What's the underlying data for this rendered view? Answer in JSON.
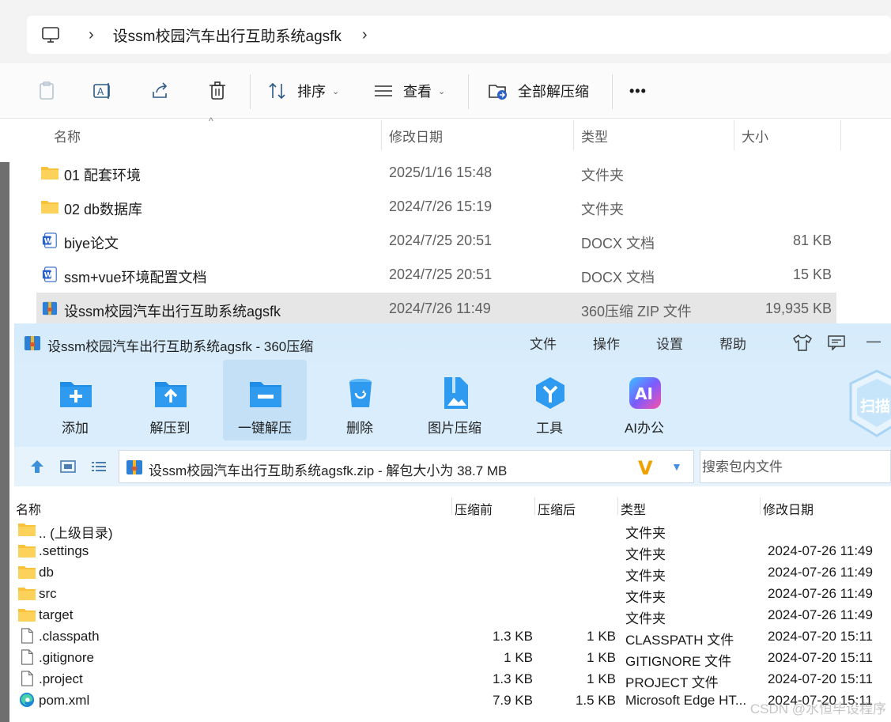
{
  "explorer": {
    "breadcrumb": "设ssm校园汽车出行互助系统agsfk",
    "toolbar": {
      "sort_label": "排序",
      "view_label": "查看",
      "extract_all_label": "全部解压缩",
      "more_label": "•••"
    },
    "columns": {
      "name": "名称",
      "modified": "修改日期",
      "type": "类型",
      "size": "大小"
    },
    "files": [
      {
        "name": "01 配套环境",
        "date": "2025/1/16 15:48",
        "type": "文件夹",
        "size": "",
        "icon": "folder-icon"
      },
      {
        "name": "02 db数据库",
        "date": "2024/7/26 15:19",
        "type": "文件夹",
        "size": "",
        "icon": "folder-icon"
      },
      {
        "name": "biye论文",
        "date": "2024/7/25 20:51",
        "type": "DOCX 文档",
        "size": "81 KB",
        "icon": "word-doc-icon"
      },
      {
        "name": "ssm+vue环境配置文档",
        "date": "2024/7/25 20:51",
        "type": "DOCX 文档",
        "size": "15 KB",
        "icon": "word-doc-icon"
      },
      {
        "name": "设ssm校园汽车出行互助系统agsfk",
        "date": "2024/7/26 11:49",
        "type": "360压缩 ZIP 文件",
        "size": "19,935 KB",
        "icon": "zip-archive-icon",
        "selected": true
      }
    ]
  },
  "archiver": {
    "title": "设ssm校园汽车出行互助系统agsfk - 360压缩",
    "menu": [
      "文件",
      "操作",
      "设置",
      "帮助"
    ],
    "minimize_label": "—",
    "ribbon": [
      {
        "label": "添加",
        "icon": "add-icon"
      },
      {
        "label": "解压到",
        "icon": "extract-to-icon"
      },
      {
        "label": "一键解压",
        "icon": "one-click-extract-icon"
      },
      {
        "label": "删除",
        "icon": "delete-icon"
      },
      {
        "label": "图片压缩",
        "icon": "image-compress-icon"
      },
      {
        "label": "工具",
        "icon": "tools-icon"
      },
      {
        "label": "AI办公",
        "icon": "ai-office-icon"
      }
    ],
    "ai_badge": "AI",
    "scan_label": "扫描",
    "path_text": "设ssm校园汽车出行互助系统agsfk.zip - 解包大小为 38.7 MB",
    "search_placeholder": "搜索包内文件",
    "columns": {
      "name": "名称",
      "before": "压缩前",
      "after": "压缩后",
      "type": "类型",
      "modified": "修改日期"
    },
    "entries": [
      {
        "name": ".. (上级目录)",
        "before": "",
        "after": "",
        "type": "文件夹",
        "date": "",
        "icon": "folder-icon"
      },
      {
        "name": ".settings",
        "before": "",
        "after": "",
        "type": "文件夹",
        "date": "2024-07-26 11:49",
        "icon": "folder-icon"
      },
      {
        "name": "db",
        "before": "",
        "after": "",
        "type": "文件夹",
        "date": "2024-07-26 11:49",
        "icon": "folder-icon"
      },
      {
        "name": "src",
        "before": "",
        "after": "",
        "type": "文件夹",
        "date": "2024-07-26 11:49",
        "icon": "folder-icon"
      },
      {
        "name": "target",
        "before": "",
        "after": "",
        "type": "文件夹",
        "date": "2024-07-26 11:49",
        "icon": "folder-icon"
      },
      {
        "name": ".classpath",
        "before": "1.3 KB",
        "after": "1 KB",
        "type": "CLASSPATH 文件",
        "date": "2024-07-20 15:11",
        "icon": "file-icon"
      },
      {
        "name": ".gitignore",
        "before": "1 KB",
        "after": "1 KB",
        "type": "GITIGNORE 文件",
        "date": "2024-07-20 15:11",
        "icon": "file-icon"
      },
      {
        "name": ".project",
        "before": "1.3 KB",
        "after": "1 KB",
        "type": "PROJECT 文件",
        "date": "2024-07-20 15:11",
        "icon": "file-icon"
      },
      {
        "name": "pom.xml",
        "before": "7.9 KB",
        "after": "1.5 KB",
        "type": "Microsoft Edge HT...",
        "date": "2024-07-20 15:11",
        "icon": "edge-icon"
      }
    ]
  },
  "watermark": "CSDN @水恒毕设程序",
  "colors": {
    "folder": "#f8c33a",
    "word": "#2b62c9",
    "archiver_title_bg": "#d6ebfb",
    "ribbon_bg": "#d9edfc",
    "selected_row": "#e6e6e6"
  }
}
